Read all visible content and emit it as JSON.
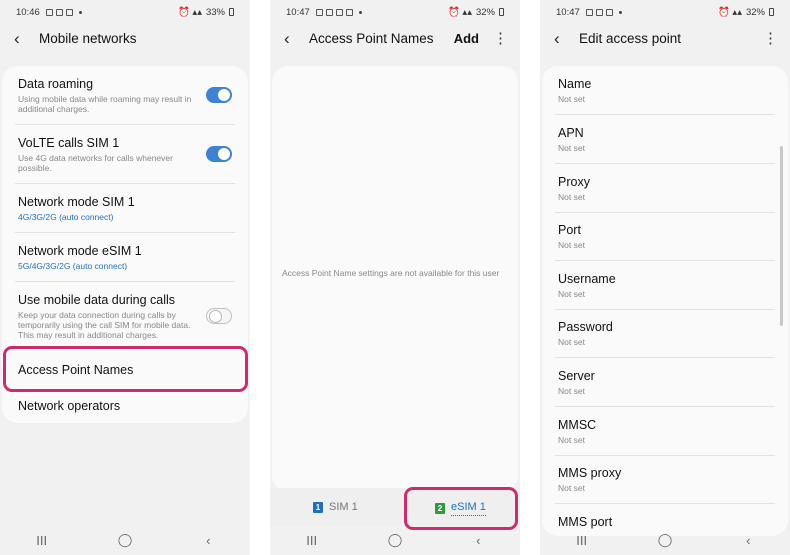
{
  "screen1": {
    "status": {
      "time": "10:46",
      "battery": "33%"
    },
    "title": "Mobile networks",
    "items": [
      {
        "title": "Data roaming",
        "subtitle": "Using mobile data while roaming may result in additional charges.",
        "toggle": "on"
      },
      {
        "title": "VoLTE calls SIM 1",
        "subtitle": "Use 4G data networks for calls whenever possible.",
        "toggle": "on"
      },
      {
        "title": "Network mode SIM 1",
        "subtitle": "4G/3G/2G (auto connect)"
      },
      {
        "title": "Network mode eSIM 1",
        "subtitle": "5G/4G/3G/2G (auto connect)"
      },
      {
        "title": "Use mobile data during calls",
        "subtitle": "Keep your data connection during calls by temporarily using the call SIM for mobile data. This may result in additional charges.",
        "toggle": "off"
      },
      {
        "title": "Access Point Names"
      },
      {
        "title": "Network operators"
      }
    ]
  },
  "screen2": {
    "status": {
      "time": "10:47",
      "battery": "32%"
    },
    "title": "Access Point Names",
    "add_label": "Add",
    "message": "Access Point Name settings are not available for this user",
    "tabs": [
      {
        "badge": "1",
        "label": "SIM 1",
        "color": "#1e70bf"
      },
      {
        "badge": "2",
        "label": "eSIM 1",
        "color": "#2e9a3c"
      }
    ]
  },
  "screen3": {
    "status": {
      "time": "10:47",
      "battery": "32%"
    },
    "title": "Edit access point",
    "fields": [
      {
        "label": "Name",
        "value": "Not set"
      },
      {
        "label": "APN",
        "value": "Not set"
      },
      {
        "label": "Proxy",
        "value": "Not set"
      },
      {
        "label": "Port",
        "value": "Not set"
      },
      {
        "label": "Username",
        "value": "Not set"
      },
      {
        "label": "Password",
        "value": "Not set"
      },
      {
        "label": "Server",
        "value": "Not set"
      },
      {
        "label": "MMSC",
        "value": "Not set"
      },
      {
        "label": "MMS proxy",
        "value": "Not set"
      },
      {
        "label": "MMS port"
      }
    ]
  },
  "navbar": {
    "recents": "III",
    "home": "◯",
    "back": "‹"
  },
  "colors": {
    "highlight": "#cc2c6e",
    "toggle_on": "#3e82d6",
    "link_blue": "#1e70bf"
  }
}
